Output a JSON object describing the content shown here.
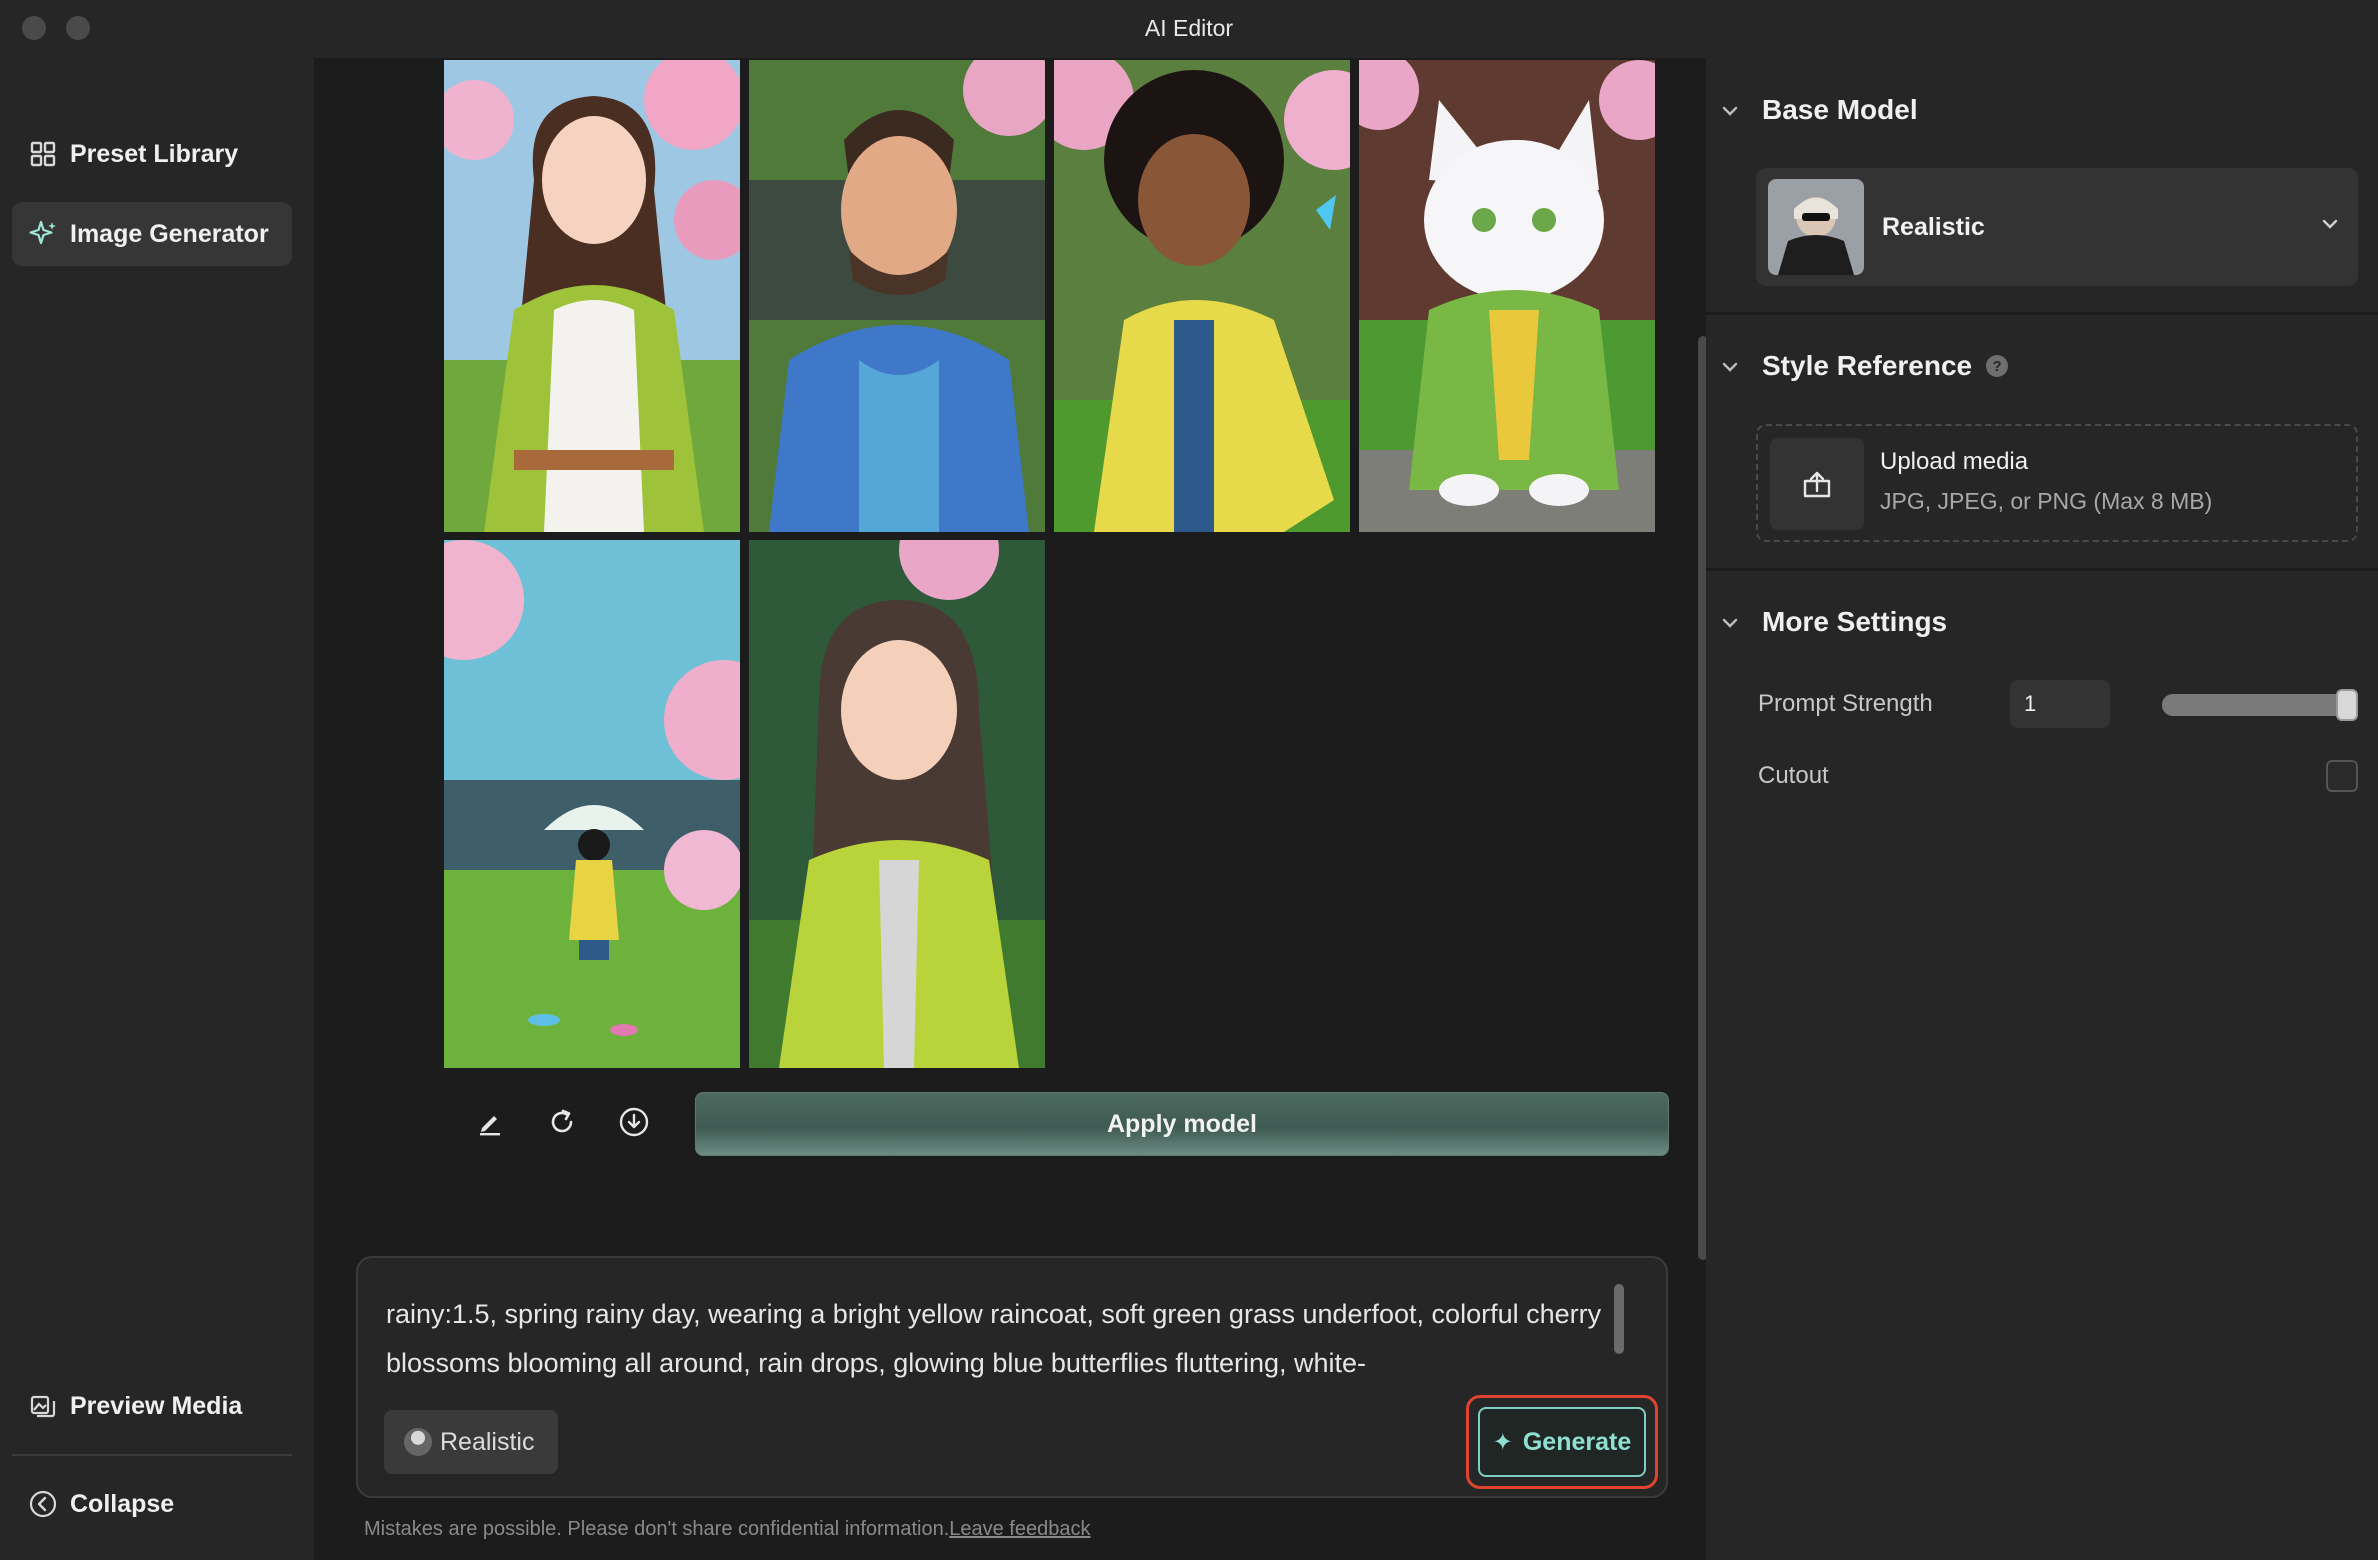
{
  "window": {
    "title": "AI Editor"
  },
  "sidebar": {
    "items": [
      {
        "label": "Preset Library",
        "icon": "grid-icon",
        "active": false
      },
      {
        "label": "Image Generator",
        "icon": "sparkle-icon",
        "active": true
      }
    ],
    "bottom": [
      {
        "label": "Preview Media",
        "icon": "preview-media-icon"
      },
      {
        "label": "Collapse",
        "icon": "collapse-icon"
      }
    ]
  },
  "gallery": {
    "images": [
      {
        "name": "generated-image-woman-green-dress"
      },
      {
        "name": "generated-image-man-blue-hoodie"
      },
      {
        "name": "generated-image-woman-yellow-coat"
      },
      {
        "name": "generated-image-white-cat"
      },
      {
        "name": "generated-image-child-umbrella"
      },
      {
        "name": "generated-image-woman-green-hoodie"
      }
    ],
    "tools": [
      "edit-icon",
      "regenerate-icon",
      "download-icon"
    ],
    "apply_label": "Apply model"
  },
  "prompt": {
    "text": "rainy:1.5, spring rainy day, wearing a bright yellow raincoat, soft green grass underfoot, colorful cherry blossoms blooming all around, rain drops, glowing blue butterflies fluttering, white-",
    "model_chip": "Realistic",
    "generate_label": "Generate"
  },
  "disclaimer": {
    "text": "Mistakes are possible. Please don't share confidential information.",
    "link": "Leave feedback"
  },
  "panel": {
    "base_model": {
      "heading": "Base Model",
      "selected": "Realistic"
    },
    "style_reference": {
      "heading": "Style Reference",
      "upload_title": "Upload media",
      "upload_hint": "JPG, JPEG, or PNG (Max 8 MB)"
    },
    "more_settings": {
      "heading": "More Settings",
      "prompt_strength_label": "Prompt Strength",
      "prompt_strength_value": "1",
      "prompt_strength_fraction": 1.0,
      "cutout_label": "Cutout",
      "cutout_checked": false
    }
  },
  "colors": {
    "accent": "#7ecfc1",
    "highlight": "#e0432f"
  }
}
